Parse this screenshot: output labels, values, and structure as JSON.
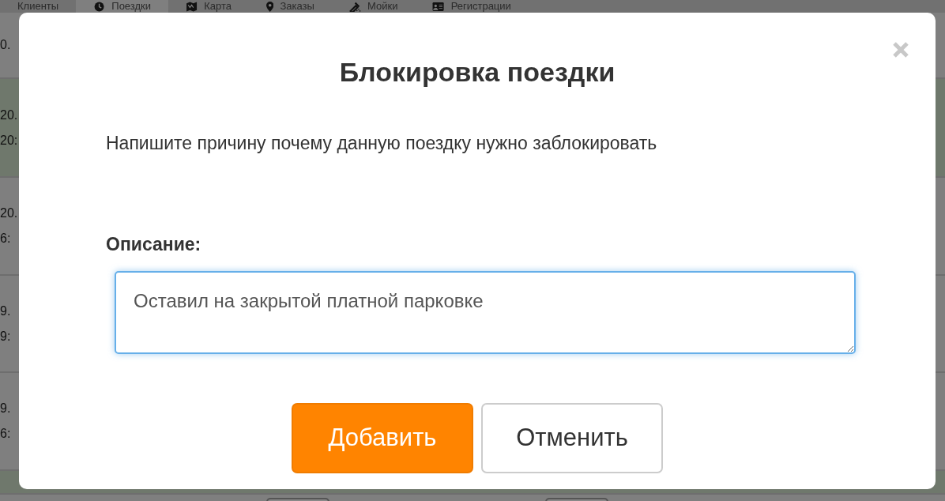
{
  "nav": [
    {
      "label": "Клиенты",
      "selected": false
    },
    {
      "label": "Поездки",
      "selected": true
    },
    {
      "label": "Карта",
      "selected": false
    },
    {
      "label": "Заказы",
      "selected": false
    },
    {
      "label": "Мойки",
      "selected": false
    },
    {
      "label": "Регистрации",
      "selected": false
    }
  ],
  "rows": [
    {
      "lines": [
        "0."
      ],
      "highlighted": false
    },
    {
      "lines": [
        "20.",
        "20:"
      ],
      "highlighted": true
    },
    {
      "lines": [
        "20.",
        "6:"
      ],
      "highlighted": false
    },
    {
      "lines": [
        "9.",
        "9:"
      ],
      "highlighted": false
    },
    {
      "lines": [
        "9.",
        "6:"
      ],
      "highlighted": false
    },
    {
      "lines": [],
      "highlighted": true
    }
  ],
  "modal": {
    "title": "Блокировка поездки",
    "text": "Напишите причину почему данную поездку нужно заблокировать",
    "label": "Описание:",
    "value": "Оставил на закрытой платной парковке",
    "buttons": [
      {
        "label": "Добавить",
        "kind": "primary"
      },
      {
        "label": "Отменить",
        "kind": "secondary"
      }
    ]
  }
}
